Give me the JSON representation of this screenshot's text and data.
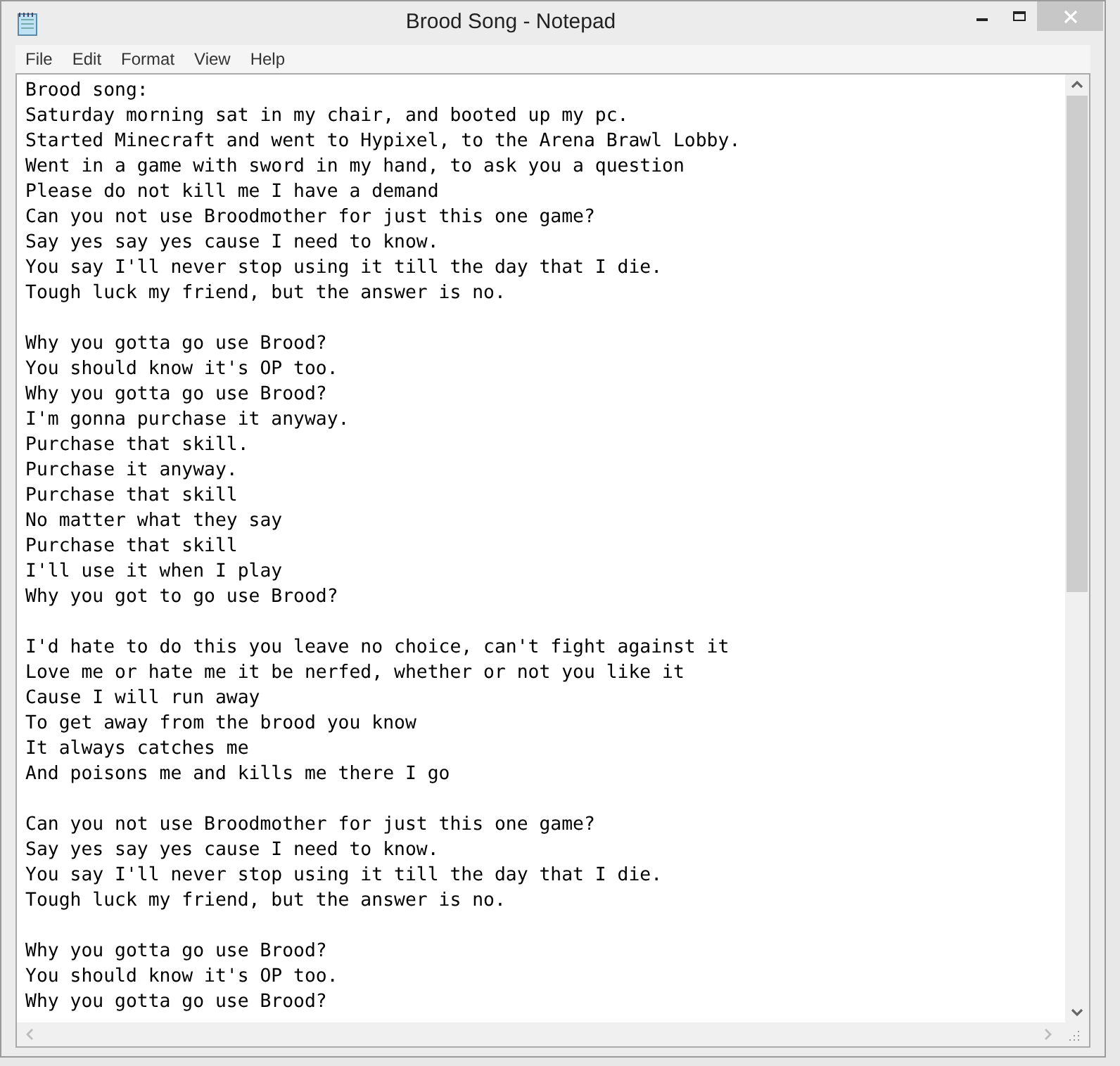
{
  "window": {
    "title": "Brood Song - Notepad"
  },
  "menu": [
    "File",
    "Edit",
    "Format",
    "View",
    "Help"
  ],
  "document": {
    "stanzas": [
      [
        "Brood song:",
        "Saturday morning sat in my chair, and booted up my pc.",
        "Started Minecraft and went to Hypixel, to the Arena Brawl Lobby.",
        "Went in a game with sword in my hand, to ask you a question",
        "Please do not kill me I have a demand",
        "Can you not use Broodmother for just this one game?",
        "Say yes say yes cause I need to know.",
        "You say I'll never stop using it till the day that I die.",
        "Tough luck my friend, but the answer is no."
      ],
      [
        "Why you gotta go use Brood?",
        "You should know it's OP too.",
        "Why you gotta go use Brood?",
        "I'm gonna purchase it anyway.",
        "Purchase that skill.",
        "Purchase it anyway.",
        "Purchase that skill",
        "No matter what they say",
        "Purchase that skill",
        "I'll use it when I play",
        "Why you got to go use Brood?"
      ],
      [
        "I'd hate to do this you leave no choice, can't fight against it",
        "Love me or hate me it be nerfed, whether or not you like it",
        "Cause I will run away",
        "To get away from the brood you know",
        "It always catches me",
        "And poisons me and kills me there I go"
      ],
      [
        "Can you not use Broodmother for just this one game?",
        "Say yes say yes cause I need to know.",
        "You say I'll never stop using it till the day that I die.",
        "Tough luck my friend, but the answer is no."
      ],
      [
        "Why you gotta go use Brood?",
        "You should know it's OP too.",
        "Why you gotta go use Brood?"
      ]
    ]
  }
}
